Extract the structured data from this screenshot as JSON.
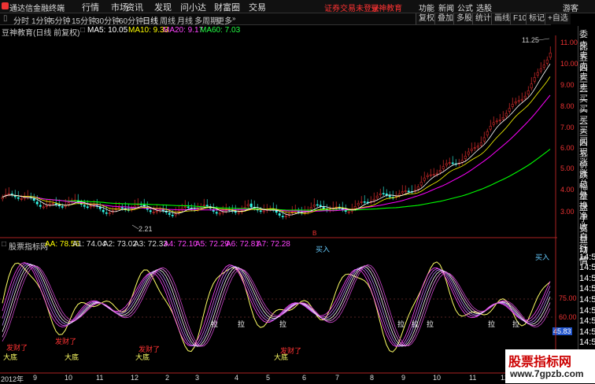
{
  "menubar": {
    "app_title": "通达信金融终端",
    "items": [
      "行情",
      "市场",
      "资讯",
      "发现",
      "问小达",
      "财富圈",
      "交易"
    ],
    "broker_warning": "证券交易未登录",
    "edu_link": "豆神教育",
    "right_items": [
      "功能",
      "新闻",
      "公式",
      "选股",
      "游客"
    ]
  },
  "toolbar": {
    "periods": [
      "分时",
      "1分钟",
      "5分钟",
      "15分钟",
      "30分钟",
      "60分钟",
      "日线",
      "周线",
      "月线",
      "多周期",
      "更多"
    ],
    "active_period": "日线",
    "right_buttons": [
      "复权",
      "叠加",
      "多股",
      "统计",
      "画线",
      "F10",
      "标记",
      "+自选"
    ]
  },
  "stock": {
    "name_label": "豆神教育(日线 前复权)",
    "ma5": "MA5: 10.05",
    "ma10": "MA10: 9.33",
    "ma20": "MA20: 9.17",
    "ma60": "MA60: 7.03",
    "high_label": "11.25",
    "low_label": "2.21"
  },
  "price_axis": [
    "11.00",
    "10.00",
    "9.00",
    "8.00",
    "7.00",
    "6.00",
    "5.00",
    "4.00",
    "3.00"
  ],
  "indicator": {
    "name": "股票指标网",
    "values": [
      "AA: 78.56",
      "A1: 74.04",
      "A2: 73.02",
      "A3: 72.33",
      "A4: 72.10",
      "A5: 72.29",
      "A6: 72.81",
      "A7: 72.28"
    ],
    "axis": [
      "75.00",
      "60.00",
      "45.83"
    ],
    "signals": {
      "buy": "买入",
      "bottom": "大底",
      "rich": "发财了",
      "pull": "拉",
      "red_marker": "B"
    }
  },
  "right_panel": [
    "委比",
    "卖五",
    "卖四",
    "卖三",
    "卖二",
    "卖一",
    "买一",
    "买二",
    "买三",
    "买四",
    "买五",
    "现价",
    "涨跌",
    "涨幅",
    "总量",
    "外盘",
    "换手",
    "净资",
    "收益",
    "自动",
    "行情",
    "14:5",
    "14:5",
    "14:5",
    "14:5",
    "14:5",
    "14:5",
    "14:5",
    "14:5",
    "14:5",
    "14:5"
  ],
  "date_axis": [
    "2012年",
    "9",
    "10",
    "11",
    "12",
    "2",
    "3",
    "4",
    "5",
    "6",
    "7",
    "8",
    "9",
    "10",
    "11",
    "12"
  ],
  "watermark": {
    "title": "股票指标网",
    "url": "www.7gpzb.com"
  },
  "colors": {
    "up": "#ff3333",
    "down": "#33ff66",
    "ma5": "#ffffff",
    "ma10": "#ffff00",
    "ma20": "#ff00ff",
    "ma60": "#00ff00",
    "axis": "#ee3333"
  }
}
